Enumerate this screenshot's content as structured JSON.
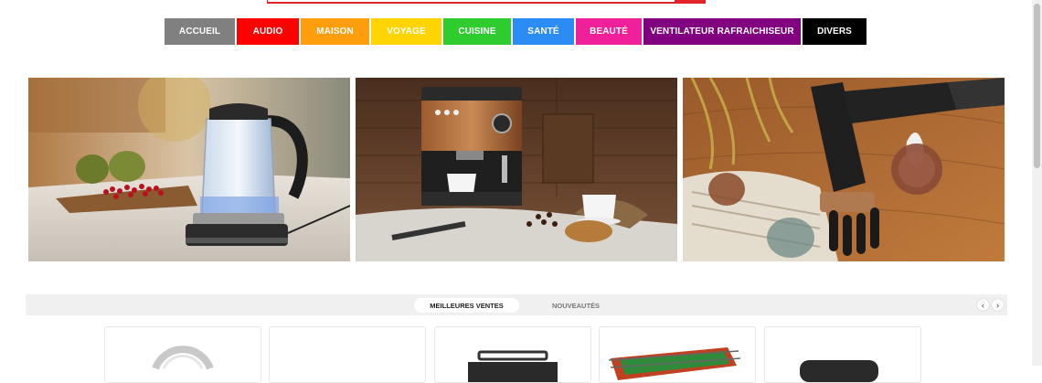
{
  "nav": {
    "items": [
      {
        "label": "ACCUEIL",
        "color": "#808080"
      },
      {
        "label": "AUDIO",
        "color": "#ff0000"
      },
      {
        "label": "MAISON",
        "color": "#ff9e0d"
      },
      {
        "label": "VOYAGE",
        "color": "#ffd400"
      },
      {
        "label": "CUISINE",
        "color": "#2ecc2e"
      },
      {
        "label": "SANTÉ",
        "color": "#2b8cf5"
      },
      {
        "label": "BEAUTÉ",
        "color": "#f0209a"
      },
      {
        "label": "VENTILATEUR RAFRAICHISEUR",
        "color": "#800080"
      },
      {
        "label": "DIVERS",
        "color": "#000000"
      }
    ]
  },
  "banners": [
    {
      "subject": "kettle-product-photo"
    },
    {
      "subject": "coffee-machine-product-photo"
    },
    {
      "subject": "hair-dryer-product-photo"
    }
  ],
  "product_tabs": {
    "active": "MEILLEURES VENTES",
    "other": "NOUVEAUTÉS",
    "prev": "‹",
    "next": "›"
  },
  "colors": {
    "accent_red": "#e2232a",
    "tabs_bg": "#f0f0f0"
  }
}
